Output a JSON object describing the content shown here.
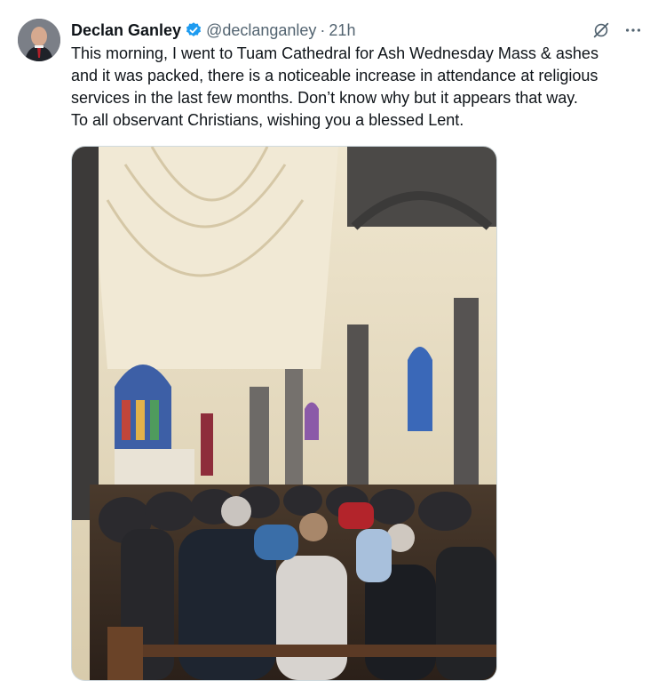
{
  "tweet": {
    "author_name": "Declan Ganley",
    "handle": "@declanganley",
    "separator": "·",
    "timestamp": "21h",
    "text_lines": [
      "This morning, I went to Tuam Cathedral for Ash Wednesday Mass & ashes",
      "and it was packed, there is a noticeable increase in attendance at religious",
      "services in the last few months. Don’t know why but it appears that way.",
      "To all observant Christians, wishing you a blessed Lent."
    ]
  },
  "icons": {
    "verified": "verified-badge-icon",
    "grok": "grok-icon",
    "more": "more-options-icon"
  },
  "colors": {
    "verified_blue": "#1d9bf0",
    "text_primary": "#0f1419",
    "text_secondary": "#536471"
  }
}
